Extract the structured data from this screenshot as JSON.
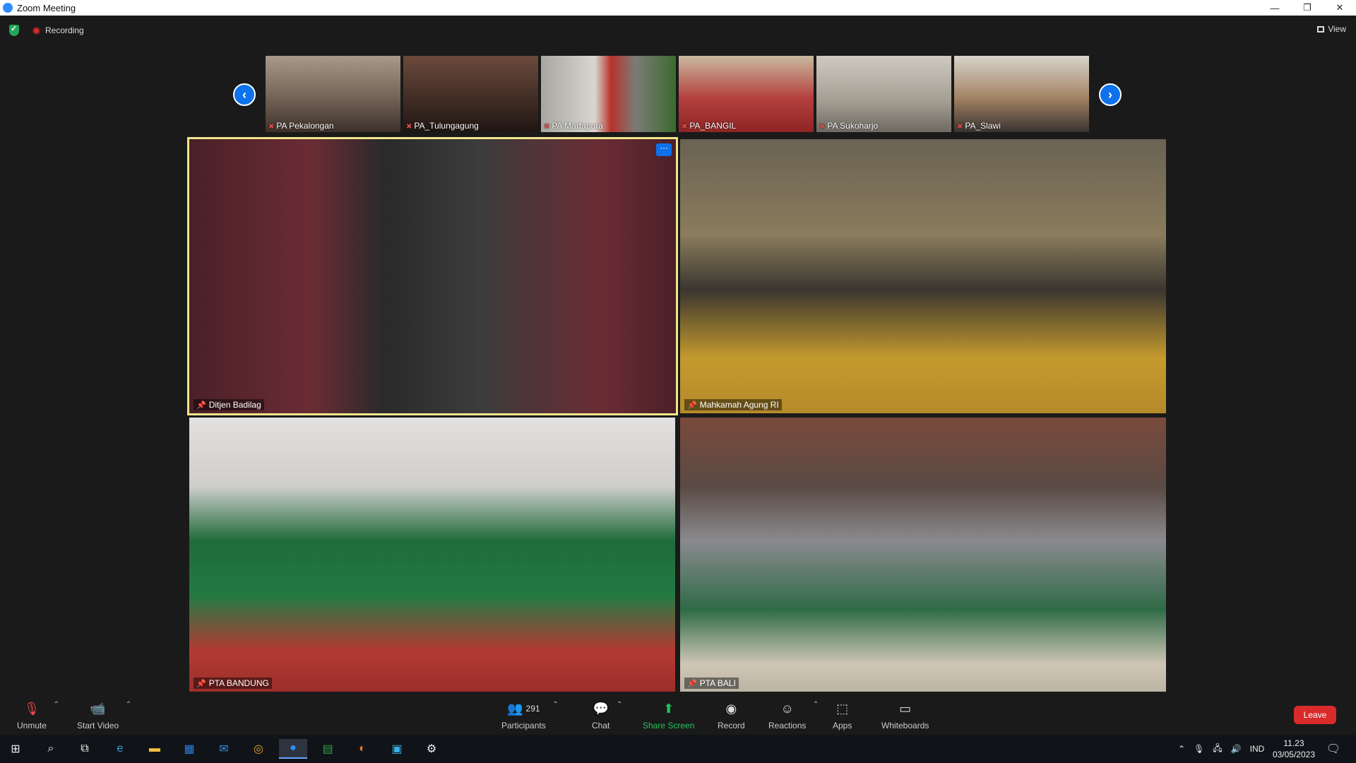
{
  "window": {
    "title": "Zoom Meeting",
    "controls": [
      "—",
      "❐",
      "✕"
    ]
  },
  "topbar": {
    "recording_label": "Recording",
    "view_label": "View"
  },
  "thumbnails": [
    {
      "name": "PA Pekalongan",
      "bg": "#8f8174"
    },
    {
      "name": "PA_Tulungagung",
      "bg": "#5a3f35"
    },
    {
      "name": "PA Martapura",
      "bg": "#8b8a84"
    },
    {
      "name": "PA_BANGIL",
      "bg": "#9a3a3a"
    },
    {
      "name": "PA Sukoharjo",
      "bg": "#a9a49b"
    },
    {
      "name": "PA_Slawi",
      "bg": "#8c7a6a"
    }
  ],
  "tiles": [
    {
      "name": "Ditjen Badilag",
      "bg": "#4a2a2a",
      "active": true
    },
    {
      "name": "Mahkamah Agung RI",
      "bg": "#5a4f3a",
      "active": false
    },
    {
      "name": "PTA BANDUNG",
      "bg": "#2e6b3f",
      "active": false
    },
    {
      "name": "PTA BALI",
      "bg": "#6a5f54",
      "active": false
    }
  ],
  "toolbar": {
    "unmute": "Unmute",
    "start_video": "Start Video",
    "participants": "Participants",
    "participant_count": "291",
    "chat": "Chat",
    "share_screen": "Share Screen",
    "record": "Record",
    "reactions": "Reactions",
    "apps": "Apps",
    "whiteboards": "Whiteboards",
    "leave": "Leave"
  },
  "taskbar": {
    "lang": "IND",
    "time": "11.23",
    "date": "03/05/2023"
  },
  "colors": {
    "accent": "#0e72ed",
    "active_border": "#f1e58c",
    "leave": "#d92b2b",
    "share": "#22c55e"
  }
}
